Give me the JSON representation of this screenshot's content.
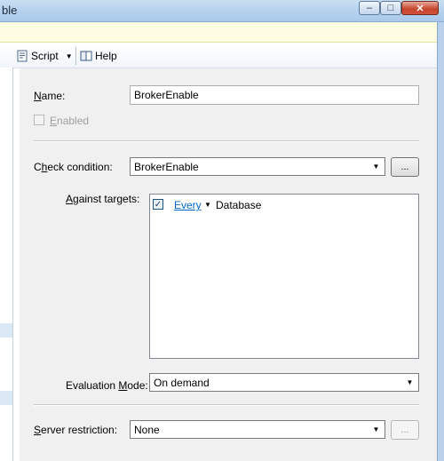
{
  "window": {
    "title_fragment": "ble"
  },
  "toolbar": {
    "script_label": "Script",
    "help_label": "Help"
  },
  "form": {
    "name_label": "Name:",
    "name_value": "BrokerEnable",
    "enabled_label": "Enabled",
    "enabled_checked": false,
    "check_condition_label": "Check condition:",
    "check_condition_value": "BrokerEnable",
    "check_condition_button": "...",
    "against_targets_label": "Against targets:",
    "targets": [
      {
        "checked": true,
        "quantifier": "Every",
        "target": "Database"
      }
    ],
    "evaluation_mode_label": "Evaluation Mode:",
    "evaluation_mode_value": "On demand",
    "server_restriction_label": "Server restriction:",
    "server_restriction_value": "None",
    "server_restriction_button": "..."
  },
  "colors": {
    "titlebar": "#b6d2ee",
    "infobar": "#fffde1",
    "panel": "#f0f0f0",
    "link": "#0066cc",
    "close_button": "#c5442d"
  },
  "icons": {
    "script": "script-icon",
    "help": "help-book-icon",
    "dropdown": "chevron-down-icon"
  }
}
